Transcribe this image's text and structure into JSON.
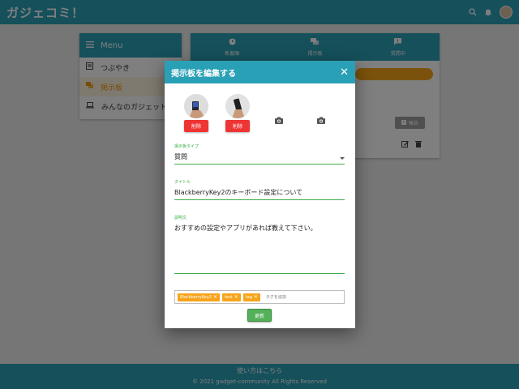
{
  "app": {
    "brand": "ガジェコミ！"
  },
  "menu": {
    "title": "Menu",
    "items": [
      {
        "label": "つぶやき"
      },
      {
        "label": "掲示板"
      },
      {
        "label": "みんなのガジェット"
      }
    ]
  },
  "board": {
    "tabs": [
      {
        "label": "新着順"
      },
      {
        "label": "掲示板"
      },
      {
        "label": "質問中"
      }
    ],
    "report_label": "報告"
  },
  "dialog": {
    "title": "掲示板を編集する",
    "delete_label": "削除",
    "board_type": {
      "label": "掲示板タイプ",
      "value": "質問"
    },
    "title_field": {
      "label": "タイトル",
      "value": "BlackberryKey2のキーボード設定について"
    },
    "description": {
      "label": "説明文",
      "value": "おすすめの設定やアプリがあれば教えて下さい。"
    },
    "tags": [
      {
        "label": "BlackberryKey2"
      },
      {
        "label": "test"
      },
      {
        "label": "tag"
      }
    ],
    "tag_placeholder": "タグを追加",
    "update_label": "更新"
  },
  "footer": {
    "link": "使い方はこちら",
    "copyright": "© 2021 gadget-community All Rights Reserved"
  },
  "colors": {
    "primary": "#2aa0b6",
    "accent": "#f6a41a",
    "danger": "#ef3434",
    "success": "#55b05a"
  }
}
